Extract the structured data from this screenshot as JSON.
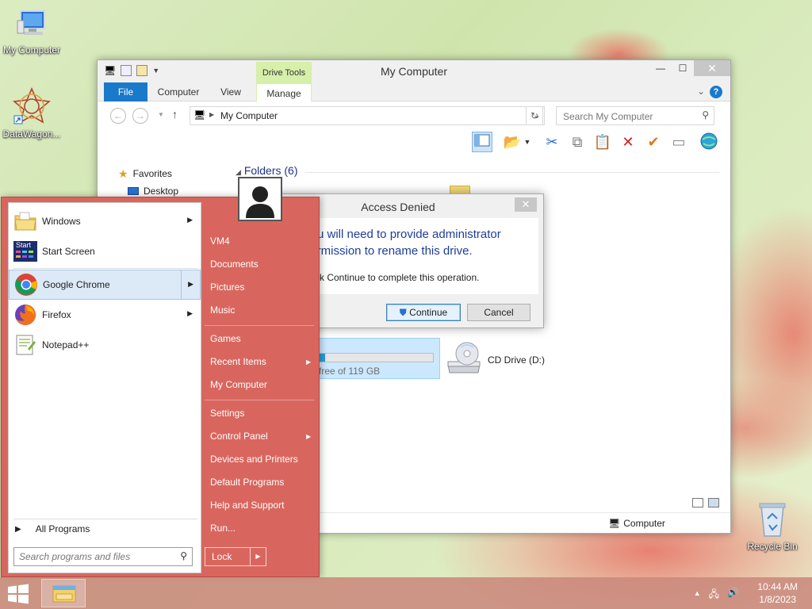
{
  "desktop": {
    "icons": [
      {
        "label": "My Computer"
      },
      {
        "label": "DataWagon..."
      },
      {
        "label": "Recycle Bin"
      }
    ]
  },
  "explorer": {
    "title": "My Computer",
    "contextual_tab_group": "Drive Tools",
    "tabs": [
      "File",
      "Computer",
      "View",
      "Manage"
    ],
    "address": "My Computer",
    "search_placeholder": "Search My Computer",
    "nav": {
      "favorites": "Favorites",
      "desktop": "Desktop"
    },
    "group_header": "Folders (6)",
    "drive": {
      "free_text": "free of 119 GB",
      "used_fraction": 0.05
    },
    "cd_drive": "CD Drive (D:)",
    "status": "Computer"
  },
  "dialog": {
    "title": "Access Denied",
    "message": "You will need to provide administrator permission to rename this drive.",
    "sub": "Click Continue to complete this operation.",
    "continue_label": "Continue",
    "cancel_label": "Cancel"
  },
  "start_menu": {
    "programs": [
      {
        "label": "Windows",
        "arrow": true
      },
      {
        "label": "Start Screen",
        "arrow": false
      },
      {
        "label": "Google Chrome",
        "arrow": true
      },
      {
        "label": "Firefox",
        "arrow": true
      },
      {
        "label": "Notepad++",
        "arrow": false
      }
    ],
    "start_screen_icon_text": "Start",
    "all_programs": "All Programs",
    "search_placeholder": "Search programs and files",
    "right_items": [
      {
        "label": "VM4",
        "arrow": false
      },
      {
        "label": "Documents",
        "arrow": false
      },
      {
        "label": "Pictures",
        "arrow": false
      },
      {
        "label": "Music",
        "arrow": false
      },
      {
        "label": "Games",
        "arrow": false
      },
      {
        "label": "Recent Items",
        "arrow": true
      },
      {
        "label": "My Computer",
        "arrow": false
      },
      {
        "label": "Settings",
        "arrow": false
      },
      {
        "label": "Control Panel",
        "arrow": true
      },
      {
        "label": "Devices and Printers",
        "arrow": false
      },
      {
        "label": "Default Programs",
        "arrow": false
      },
      {
        "label": "Help and Support",
        "arrow": false
      },
      {
        "label": "Run...",
        "arrow": false
      }
    ],
    "lock_label": "Lock"
  },
  "taskbar": {
    "time": "10:44 AM",
    "date": "1/8/2023",
    "tray_arrow": "▲"
  },
  "colors": {
    "accent": "#1979ca",
    "start_menu": "#d9665e",
    "drive_tools": "#d6efa9"
  }
}
